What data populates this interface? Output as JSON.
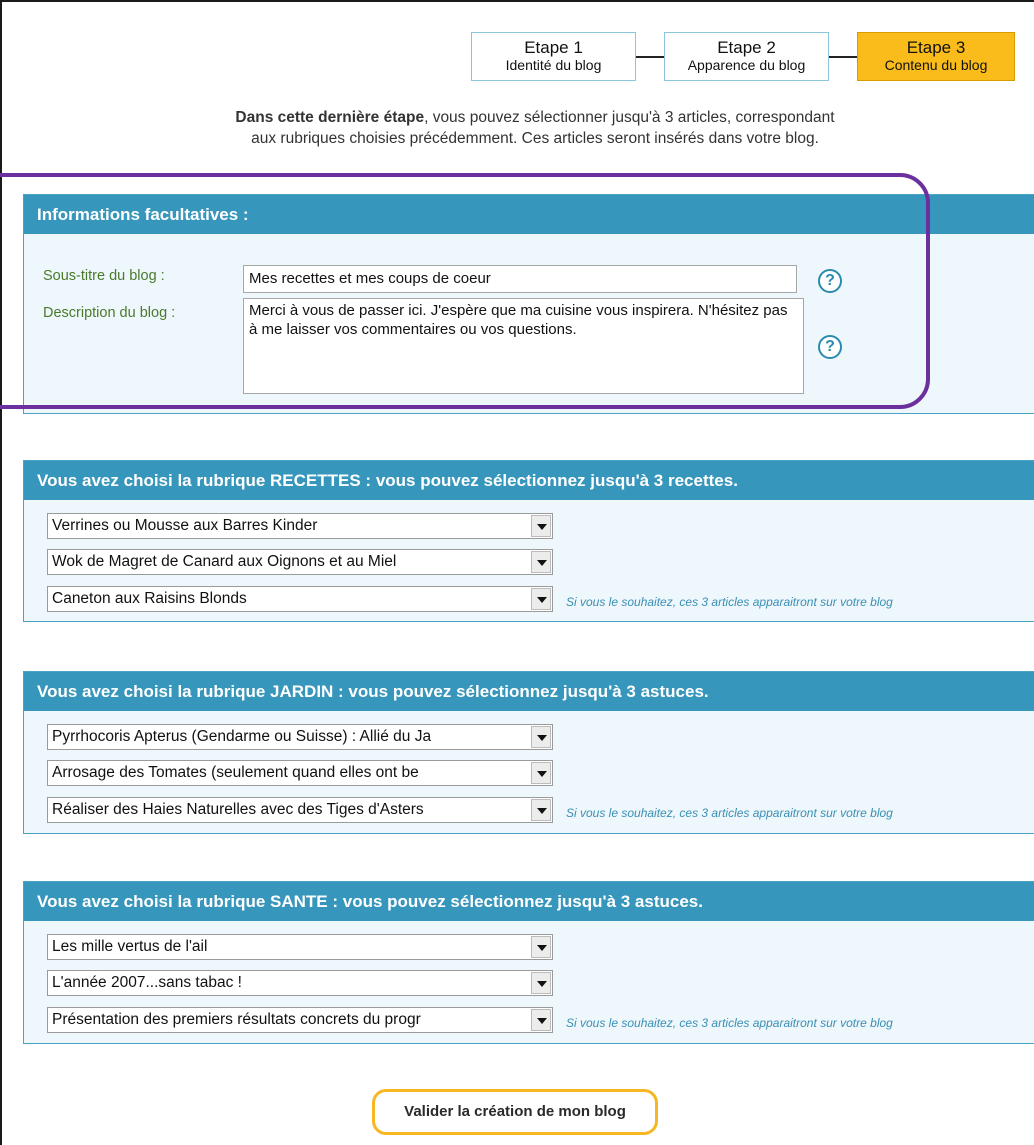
{
  "steps": [
    {
      "number": "Etape 1",
      "label": "Identité du blog"
    },
    {
      "number": "Etape 2",
      "label": "Apparence du blog"
    },
    {
      "number": "Etape 3",
      "label": "Contenu du blog"
    }
  ],
  "intro": {
    "bold": "Dans cette dernière étape",
    "rest": ", vous pouvez sélectionner jusqu'à 3 articles, correspondant",
    "line2": "aux rubriques choisies précédemment. Ces articles seront insérés dans votre blog."
  },
  "info_panel": {
    "header": "Informations facultatives :",
    "subtitle_label": "Sous-titre du blog :",
    "subtitle_value": "Mes recettes et mes coups de coeur",
    "description_label": "Description du blog :",
    "description_value": "Merci à vous de passer ici. J'espère que ma cuisine vous inspirera. N'hésitez pas à me laisser vos commentaires ou vos questions.",
    "help_glyph": "?"
  },
  "sections": [
    {
      "header": "Vous avez choisi la rubrique RECETTES : vous pouvez sélectionnez jusqu'à 3 recettes.",
      "selects": [
        "Verrines ou Mousse aux Barres Kinder",
        "Wok de Magret de Canard aux Oignons et au Miel",
        "Caneton aux Raisins Blonds"
      ],
      "note": "Si vous le souhaitez, ces 3 articles apparaitront sur votre blog"
    },
    {
      "header": "Vous avez choisi la rubrique JARDIN : vous pouvez sélectionnez jusqu'à 3 astuces.",
      "selects": [
        "Pyrrhocoris Apterus (Gendarme ou Suisse) : Allié du Ja",
        "Arrosage des Tomates (seulement quand elles ont be",
        "Réaliser des Haies Naturelles avec des Tiges d'Asters"
      ],
      "note": "Si vous le souhaitez, ces 3 articles apparaitront sur votre blog"
    },
    {
      "header": "Vous avez choisi la rubrique SANTE : vous pouvez sélectionnez jusqu'à 3 astuces.",
      "selects": [
        "Les mille vertus de l'ail",
        "L'année 2007...sans tabac !",
        "Présentation des premiers résultats concrets du progr"
      ],
      "note": "Si vous le souhaitez, ces 3 articles apparaitront sur votre blog"
    }
  ],
  "submit_label": "Valider la création de mon blog",
  "colors": {
    "header_blue": "#3796bb",
    "panel_bg": "#eef7fb",
    "active_step": "#f9bc1b",
    "label_green": "#4b7a2c",
    "highlight_purple": "#6b2f9e",
    "note_blue": "#3a8fb5"
  }
}
